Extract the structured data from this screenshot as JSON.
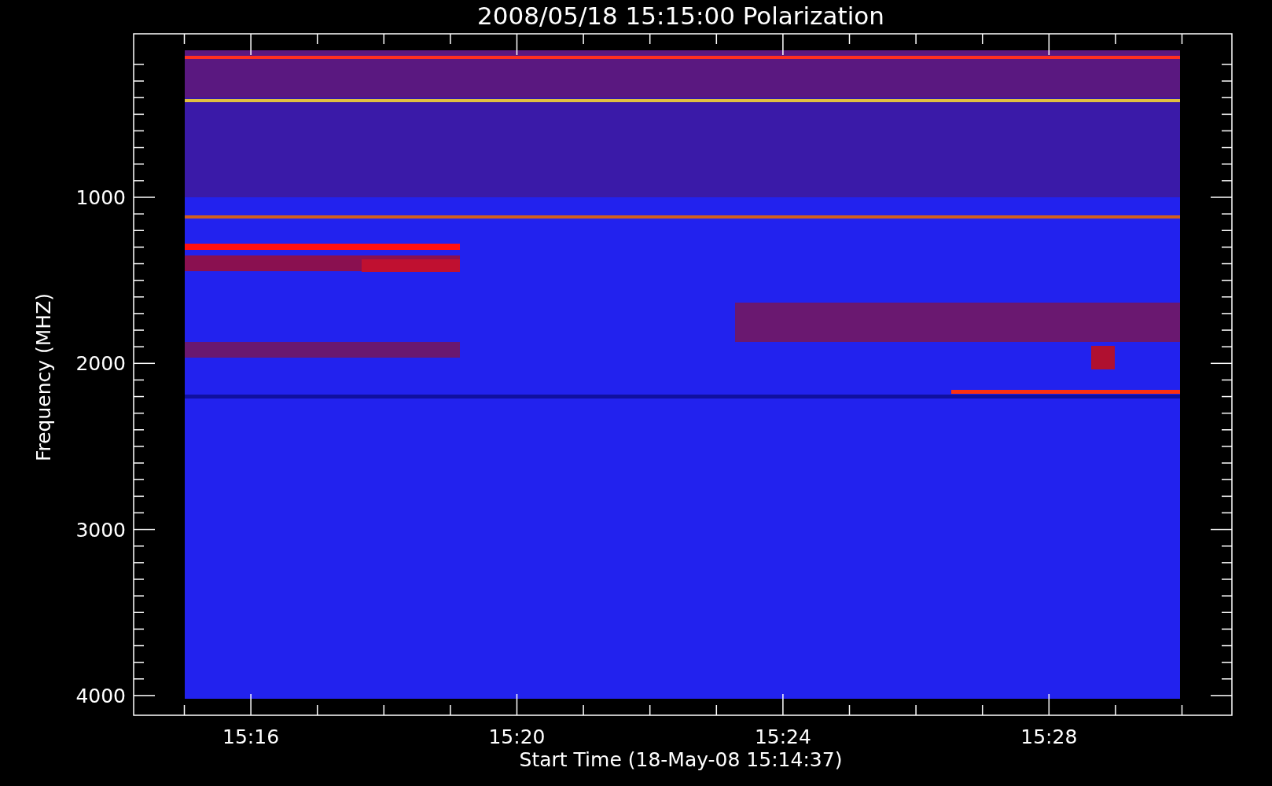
{
  "plot": {
    "title": "2008/05/18 15:15:00 Polarization",
    "y_axis": {
      "label": "Frequency (MHZ)",
      "ticks": [
        "1000",
        "2000",
        "3000",
        "4000"
      ]
    },
    "x_axis": {
      "label": "Start Time (18-May-08 15:14:37)",
      "ticks": [
        "15:16",
        "15:20",
        "15:24",
        "15:28"
      ]
    }
  }
}
